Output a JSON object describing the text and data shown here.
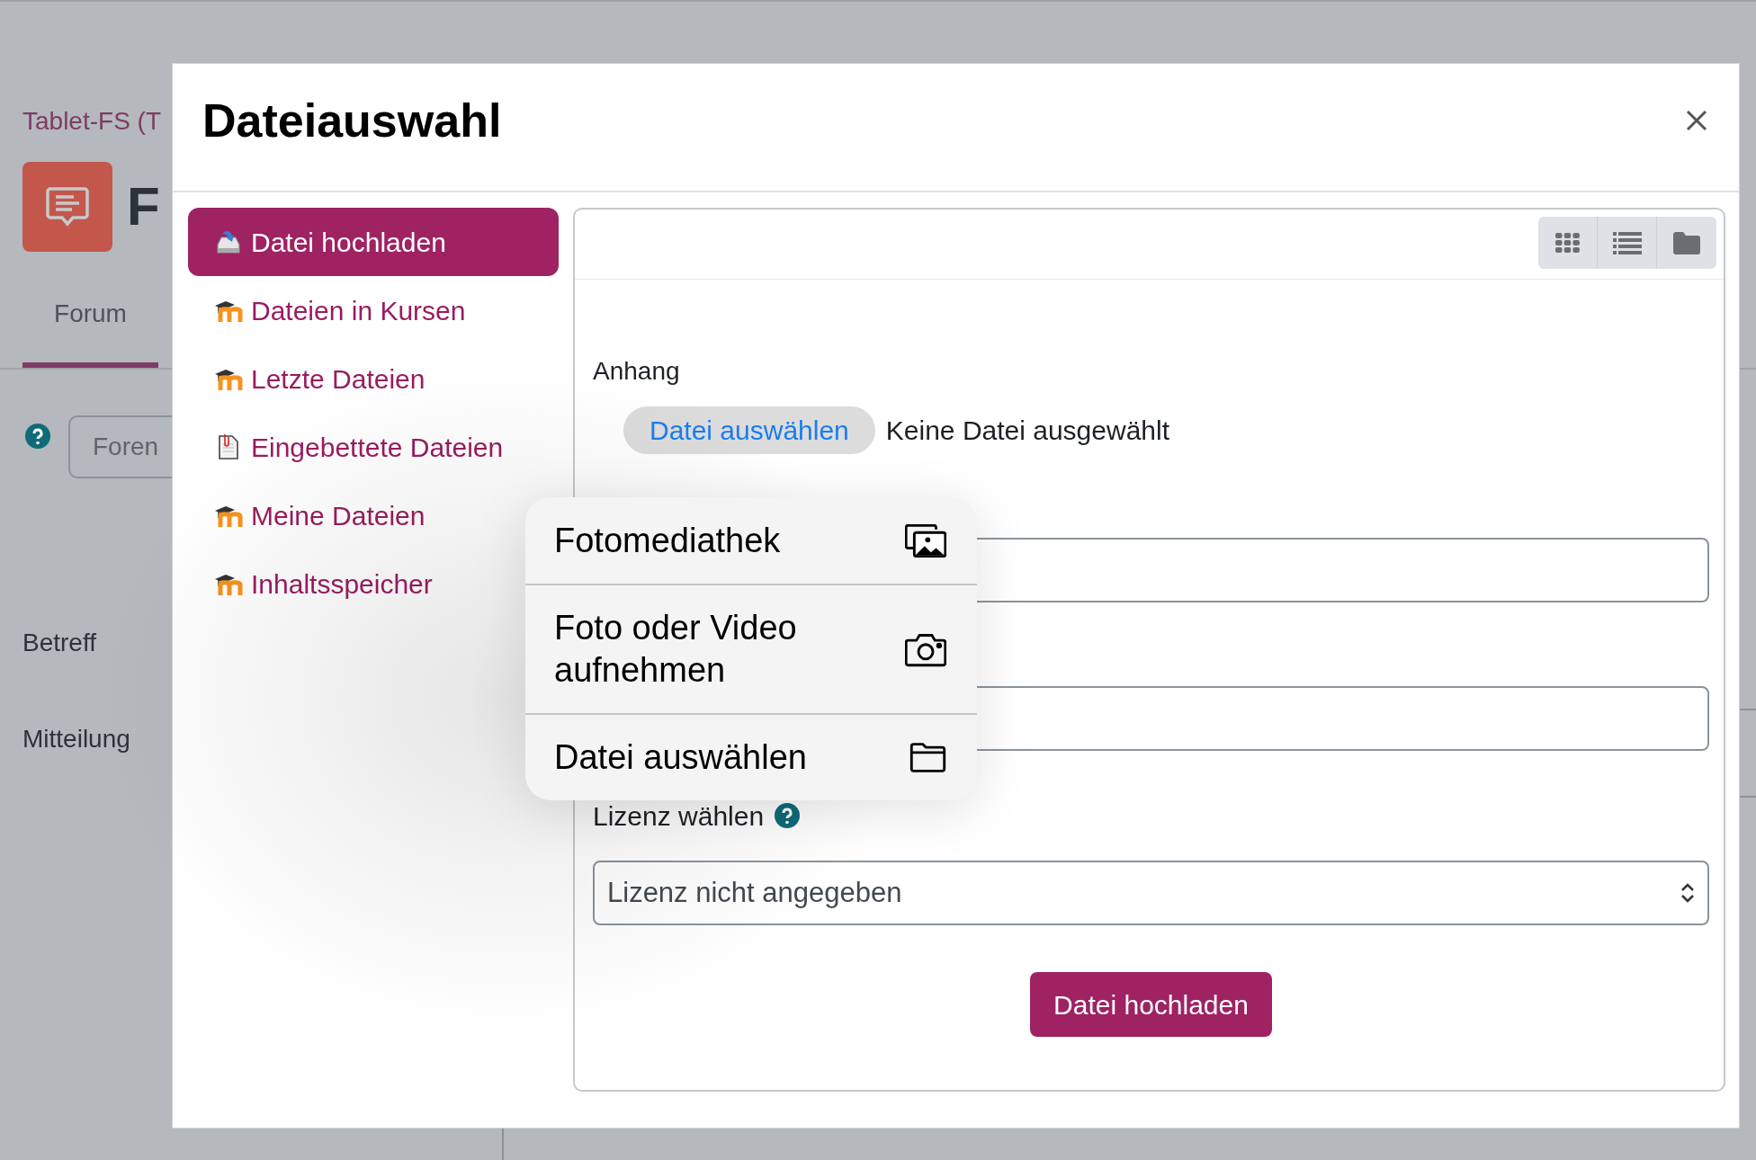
{
  "background_page": {
    "breadcrumb": "Tablet-FS (T",
    "heading": "F",
    "tabs": [
      {
        "label": "Forum",
        "selected": true
      }
    ],
    "search": {
      "placeholder": "Foren"
    },
    "form_labels": [
      "Betreff",
      "Mitteilung"
    ]
  },
  "dialog": {
    "title": "Dateiauswahl",
    "repositories": [
      {
        "label": "Datei hochladen",
        "kind": "upload",
        "selected": true
      },
      {
        "label": "Dateien in Kursen",
        "kind": "moodle",
        "selected": false
      },
      {
        "label": "Letzte Dateien",
        "kind": "moodle",
        "selected": false
      },
      {
        "label": "Eingebettete Dateien",
        "kind": "document",
        "selected": false
      },
      {
        "label": "Meine Dateien",
        "kind": "moodle",
        "selected": false
      },
      {
        "label": "Inhaltsspeicher",
        "kind": "moodle",
        "selected": false
      }
    ],
    "form": {
      "attachment_label": "Anhang",
      "file_button": "Datei auswählen",
      "file_status": "Keine Datei ausgewählt",
      "license_label": "Lizenz wählen",
      "license_value": "Lizenz nicht angegeben",
      "submit": "Datei hochladen"
    }
  },
  "picker_menu": [
    {
      "label": "Fotomediathek",
      "kind": "photos"
    },
    {
      "label": "Foto oder Video aufnehmen",
      "kind": "camera"
    },
    {
      "label": "Datei auswählen",
      "kind": "folder"
    }
  ]
}
